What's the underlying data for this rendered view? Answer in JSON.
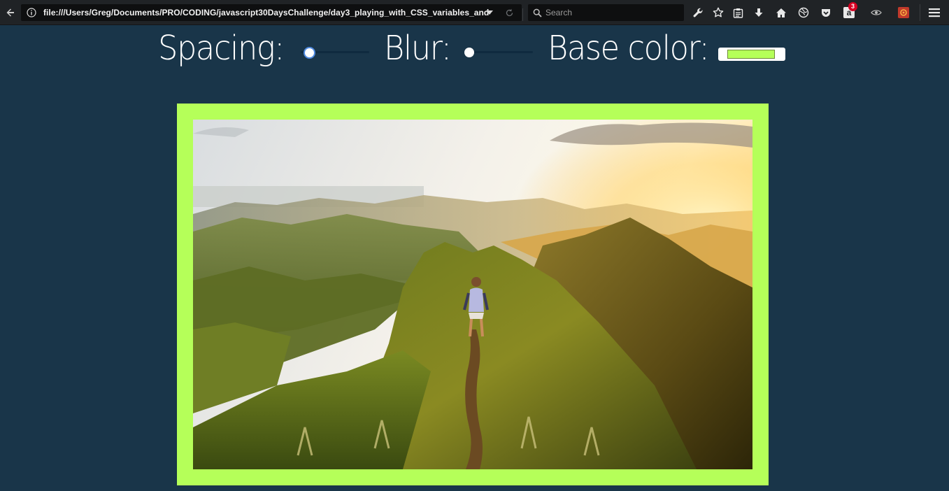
{
  "browser": {
    "url": "file:///Users/Greg/Documents/PRO/CODING/javascript30DaysChallenge/day3_playing_with_CSS_variables_and",
    "search_placeholder": "Search",
    "notification_badge": "3",
    "icons": [
      "back-arrow-icon",
      "info-icon",
      "dropdown-arrow-icon",
      "reload-icon",
      "search-icon",
      "wrench-icon",
      "star-icon",
      "clipboard-icon",
      "download-icon",
      "home-icon",
      "globe-icon",
      "pocket-icon",
      "amazon-icon",
      "extension-icon",
      "addon-icon",
      "hamburger-menu-icon"
    ]
  },
  "controls": {
    "spacing_label": "Spacing:",
    "spacing_value": 0.1,
    "blur_label": "Blur:",
    "blur_value": 0,
    "base_color_label": "Base color:",
    "base_color": "#b5ff59"
  },
  "colors": {
    "page_background": "#193549",
    "frame_color": "#b5ff59"
  }
}
